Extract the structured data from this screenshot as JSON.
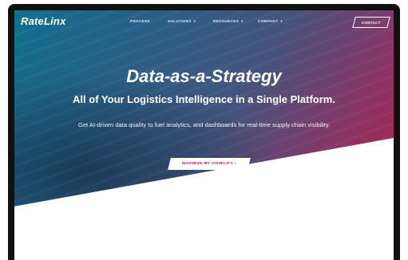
{
  "brand": {
    "logo": "RateLinx"
  },
  "nav": {
    "items": [
      {
        "label": "PROCESS",
        "has_dropdown": false
      },
      {
        "label": "SOLUTIONS",
        "has_dropdown": true
      },
      {
        "label": "RESOURCES",
        "has_dropdown": true
      },
      {
        "label": "COMPANY",
        "has_dropdown": true
      }
    ],
    "contact_label": "CONTACT"
  },
  "hero": {
    "headline": "Data-as-a-Strategy",
    "subhead": "All of Your Logistics Intelligence in a Single Platform.",
    "description": "Get AI-driven data quality to fuel analytics, and dashboards for real-time supply chain visibility.",
    "cta_label": "MAXIMIZE MY VISIBILITY ›"
  },
  "colors": {
    "gradient_start": "#0f6f8f",
    "gradient_end": "#b51f45",
    "cta_text": "#b3203f"
  },
  "icons": {
    "dropdown": "caret-down-icon"
  }
}
